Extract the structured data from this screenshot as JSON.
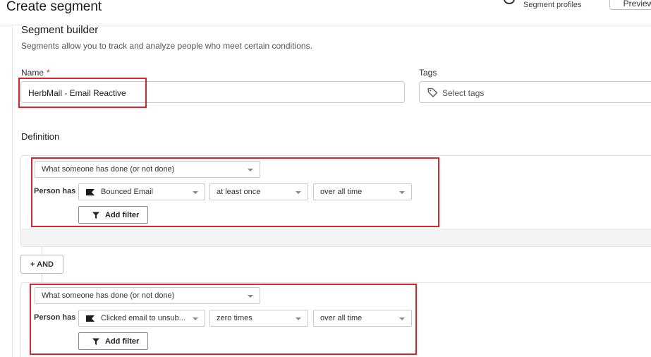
{
  "header": {
    "title": "Create segment",
    "profiles_label": "Segment profiles",
    "preview_label": "Preview"
  },
  "builder": {
    "title": "Segment builder",
    "description": "Segments allow you to track and analyze people who meet certain conditions."
  },
  "name_field": {
    "label": "Name",
    "required_mark": "*",
    "value": "HerbMail - Email Reactive"
  },
  "tags_field": {
    "label": "Tags",
    "placeholder": "Select tags"
  },
  "definition": {
    "label": "Definition",
    "and_label": "+ AND",
    "conditions": [
      {
        "type_select": "What someone has done (or not done)",
        "person_has": "Person has",
        "metric": "Bounced Email",
        "frequency": "at least once",
        "timeframe": "over all time",
        "add_filter": "Add filter"
      },
      {
        "type_select": "What someone has done (or not done)",
        "person_has": "Person has",
        "metric": "Clicked email to unsub...",
        "frequency": "zero times",
        "timeframe": "over all time",
        "add_filter": "Add filter"
      }
    ]
  },
  "colors": {
    "highlight": "#d9242c",
    "footer_bg": "#f3f4f4"
  }
}
